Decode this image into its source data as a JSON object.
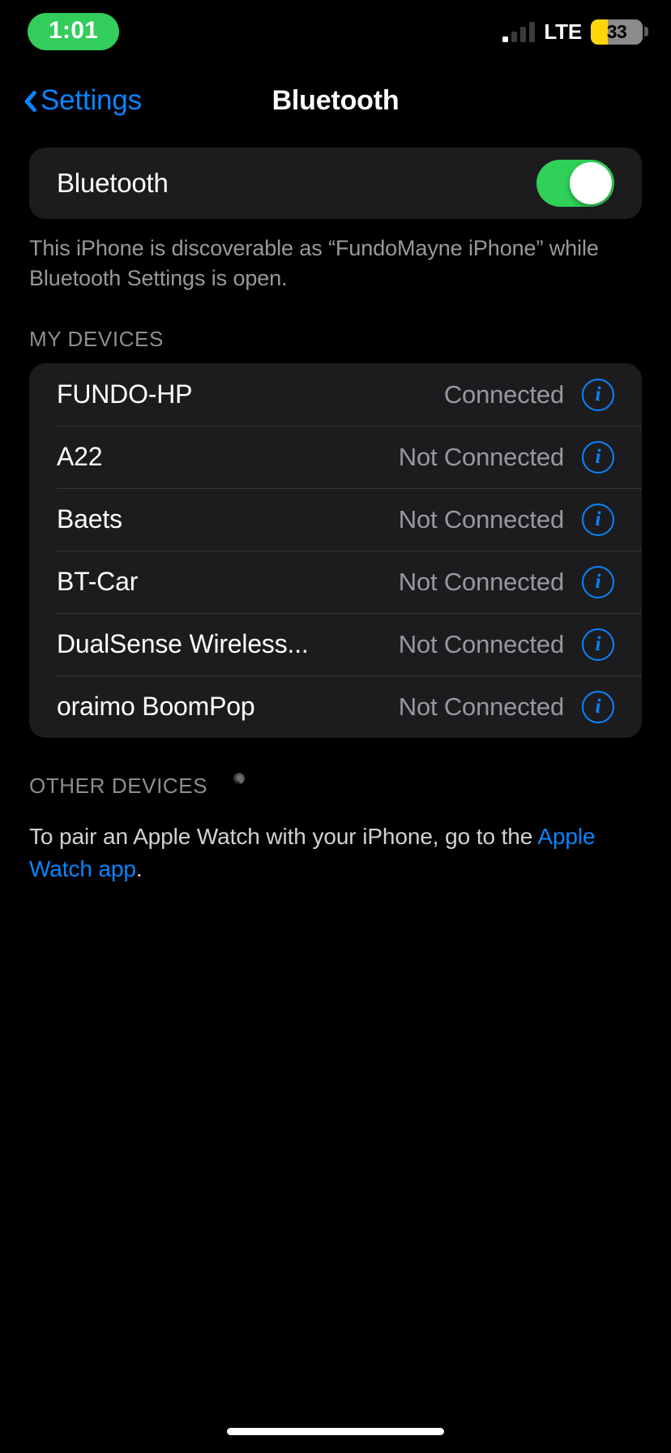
{
  "status_bar": {
    "time": "1:01",
    "time_pill_color": "#32CD5A",
    "carrier_label": "LTE",
    "signal_bars_filled": 1,
    "signal_bars_total": 4,
    "battery_percent": "33",
    "battery_fill_color": "#FFD60A",
    "battery_body_color": "#8B8B8B"
  },
  "nav": {
    "back_label": "Settings",
    "title": "Bluetooth",
    "accent_color": "#0A84FF"
  },
  "bluetooth_toggle": {
    "label": "Bluetooth",
    "state": "on",
    "on_color": "#30D158"
  },
  "discoverable_note": "This iPhone is discoverable as “FundoMayne iPhone” while Bluetooth Settings is open.",
  "my_devices": {
    "header": "MY DEVICES",
    "devices": [
      {
        "name": "FUNDO-HP",
        "status": "Connected"
      },
      {
        "name": "A22",
        "status": "Not Connected"
      },
      {
        "name": "Baets",
        "status": "Not Connected"
      },
      {
        "name": "BT-Car",
        "status": "Not Connected"
      },
      {
        "name": "DualSense Wireless...",
        "status": "Not Connected"
      },
      {
        "name": "oraimo BoomPop",
        "status": "Not Connected"
      }
    ]
  },
  "other_devices": {
    "header": "OTHER DEVICES",
    "scanning": true,
    "pair_note_prefix": "To pair an Apple Watch with your iPhone, go to the ",
    "pair_note_link": "Apple Watch app",
    "pair_note_suffix": "."
  },
  "icons": {
    "info": "i"
  }
}
